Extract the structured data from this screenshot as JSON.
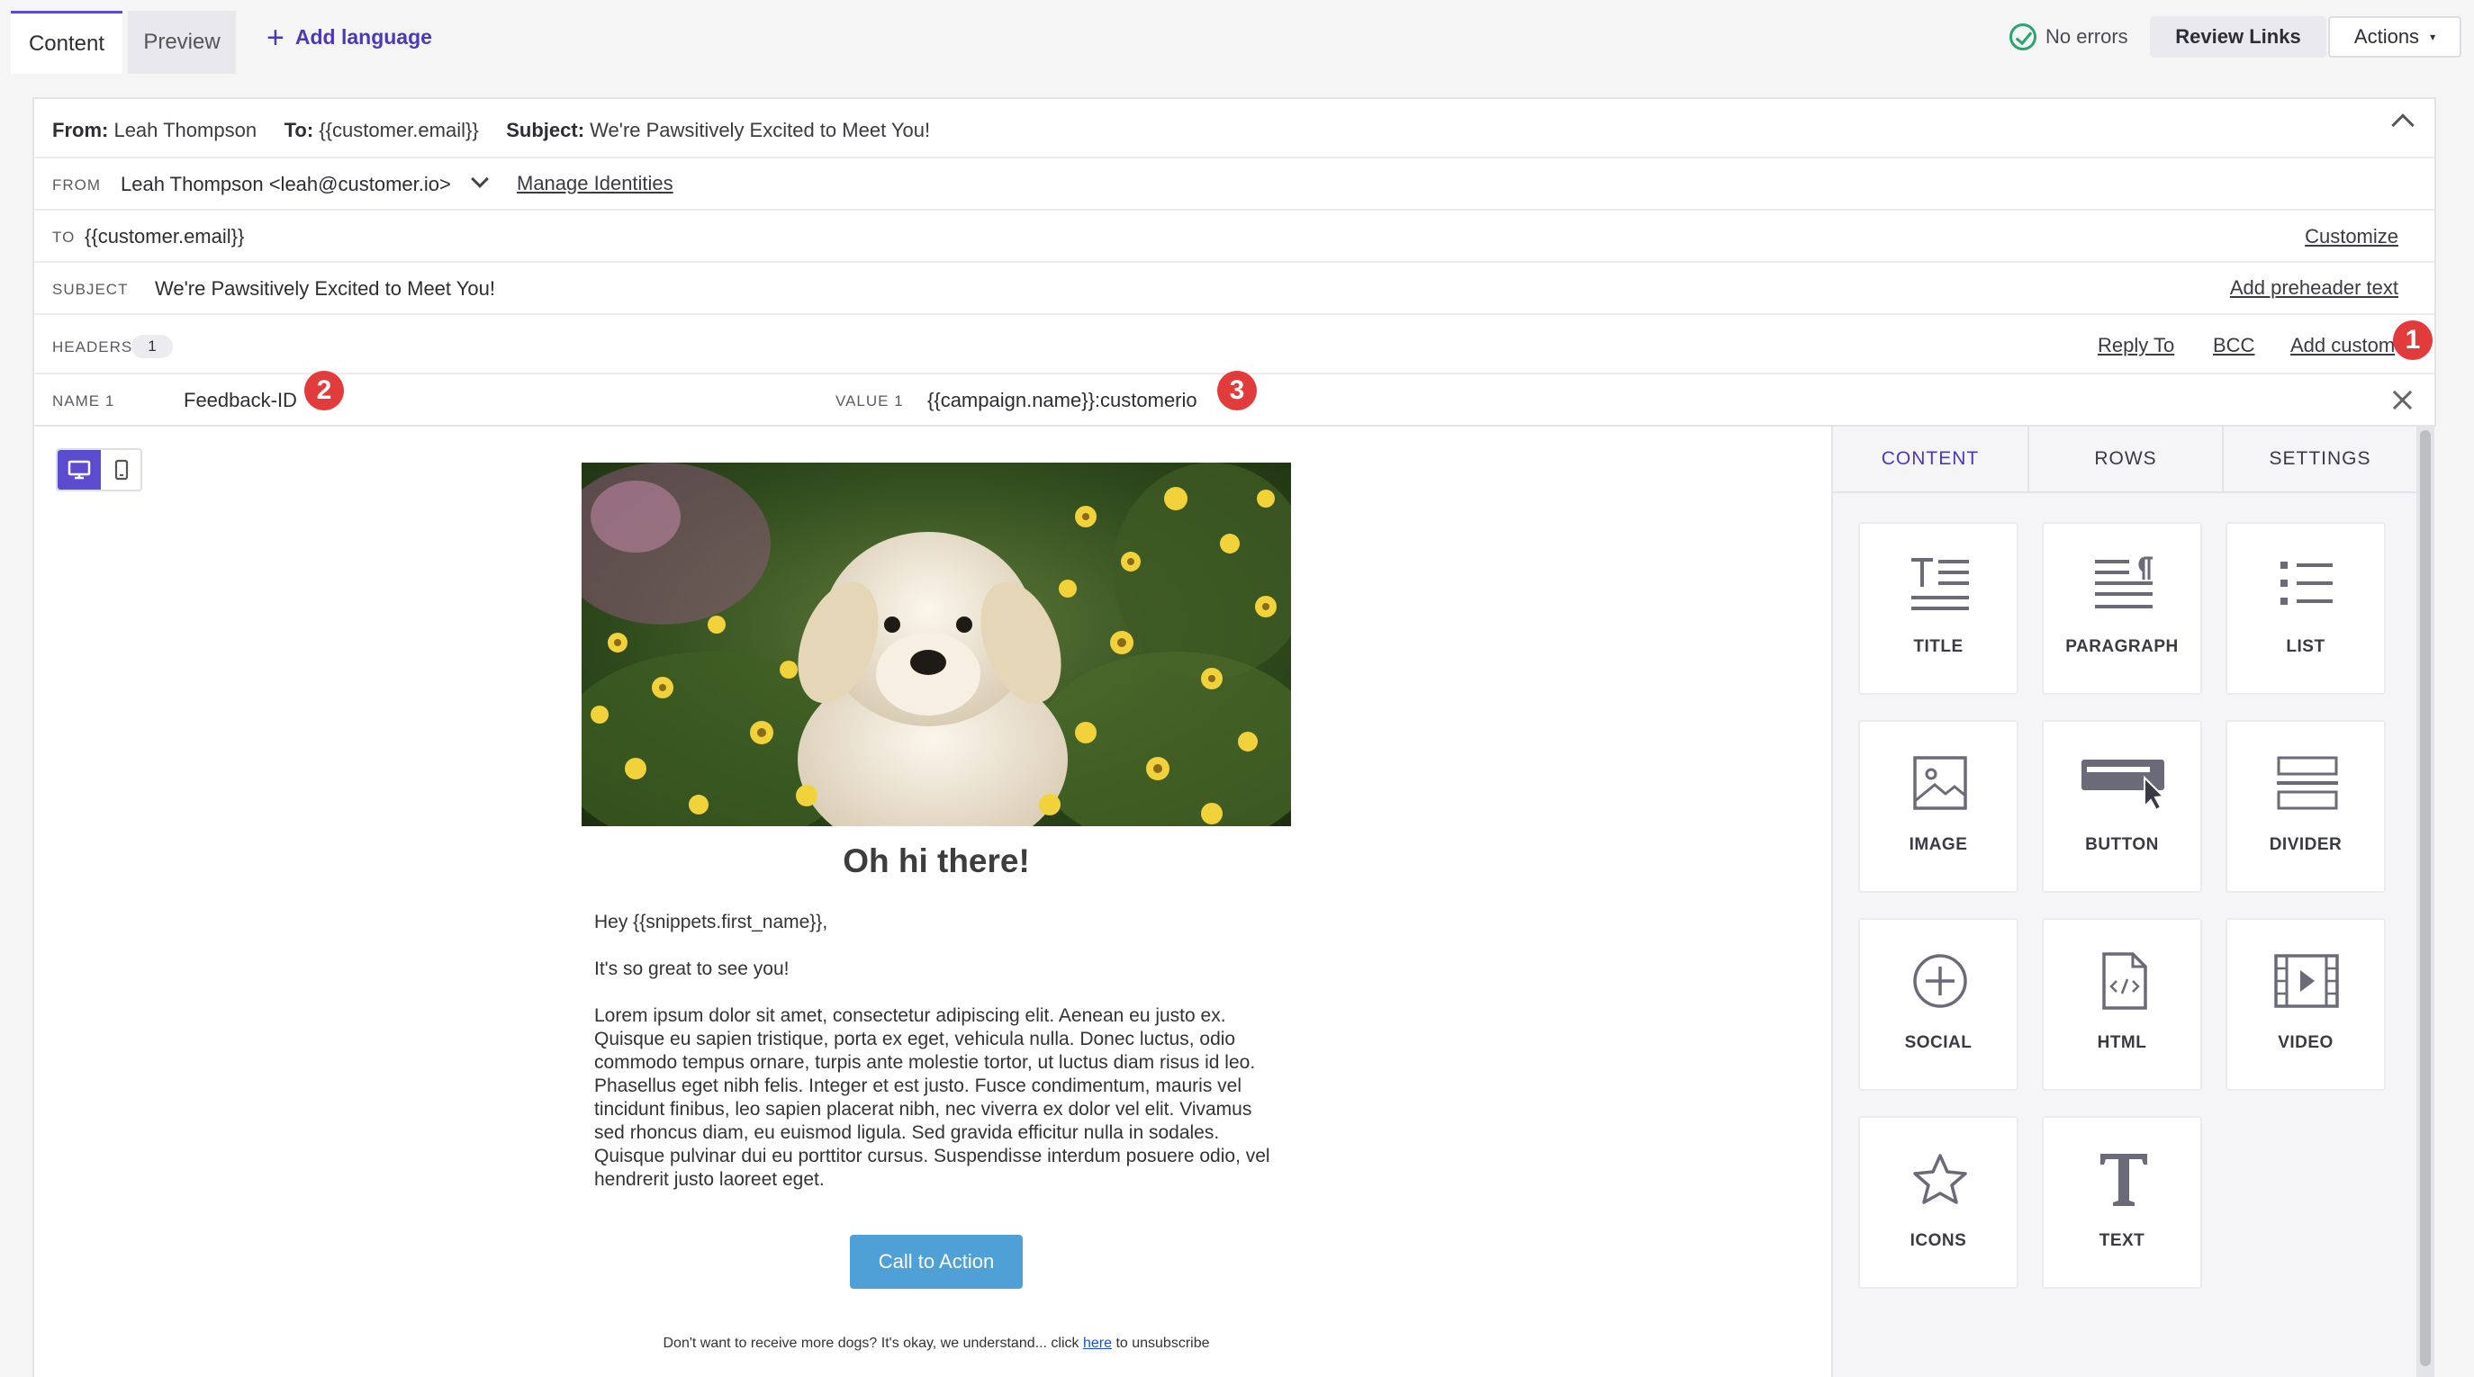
{
  "tabs": {
    "content": "Content",
    "preview": "Preview",
    "add_language": "Add language"
  },
  "status": {
    "no_errors": "No errors"
  },
  "buttons": {
    "review_links": "Review Links",
    "actions": "Actions"
  },
  "summary": {
    "from_label": "From:",
    "from_value": "Leah Thompson",
    "to_label": "To:",
    "to_value": "{{customer.email}}",
    "subject_label": "Subject:",
    "subject_value": "We're Pawsitively Excited to Meet You!"
  },
  "from_row": {
    "label": "FROM",
    "value": "Leah Thompson <leah@customer.io>",
    "link": "Manage Identities"
  },
  "to_row": {
    "label": "TO",
    "value": "{{customer.email}}",
    "link": "Customize"
  },
  "subject_row": {
    "label": "SUBJECT",
    "value": "We're Pawsitively Excited to Meet You!",
    "link": "Add preheader text"
  },
  "headers_row": {
    "label": "HEADERS",
    "count": "1",
    "reply_to": "Reply To",
    "bcc": "BCC",
    "add_custom": "Add custom"
  },
  "custom_header": {
    "name_label": "NAME 1",
    "name_value": "Feedback-ID",
    "value_label": "VALUE 1",
    "value_value": "{{campaign.name}}:customerio"
  },
  "markers": {
    "m1": "1",
    "m2": "2",
    "m3": "3"
  },
  "email": {
    "title": "Oh hi there!",
    "greeting": "Hey {{snippets.first_name}},",
    "line2": "It's so great to see you!",
    "body": "Lorem ipsum dolor sit amet, consectetur adipiscing elit. Aenean eu justo ex. Quisque eu sapien tristique, porta ex eget, vehicula nulla. Donec luctus, odio commodo tempus ornare, turpis ante molestie tortor, ut luctus diam risus id leo. Phasellus eget nibh felis. Integer et est justo. Fusce condimentum, mauris vel tincidunt finibus, leo sapien placerat nibh, nec viverra ex dolor vel elit. Vivamus sed rhoncus diam, eu euismod ligula. Sed gravida efficitur nulla in sodales. Quisque pulvinar dui eu porttitor cursus. Suspendisse interdum posuere odio, vel hendrerit justo laoreet eget.",
    "cta": "Call to Action",
    "footer_before": "Don't want to receive more dogs? It's okay, we understand... click ",
    "footer_link": "here",
    "footer_after": " to unsubscribe"
  },
  "panel": {
    "tabs": [
      "CONTENT",
      "ROWS",
      "SETTINGS"
    ],
    "blocks": [
      "TITLE",
      "PARAGRAPH",
      "LIST",
      "IMAGE",
      "BUTTON",
      "DIVIDER",
      "SOCIAL",
      "HTML",
      "VIDEO",
      "ICONS",
      "TEXT"
    ]
  },
  "colors": {
    "accent": "#5b4bcf",
    "link_purple": "#4a3ab8",
    "cta_blue": "#4ea0d6",
    "marker_red": "#e23b3b",
    "success_green": "#2aa56f"
  }
}
